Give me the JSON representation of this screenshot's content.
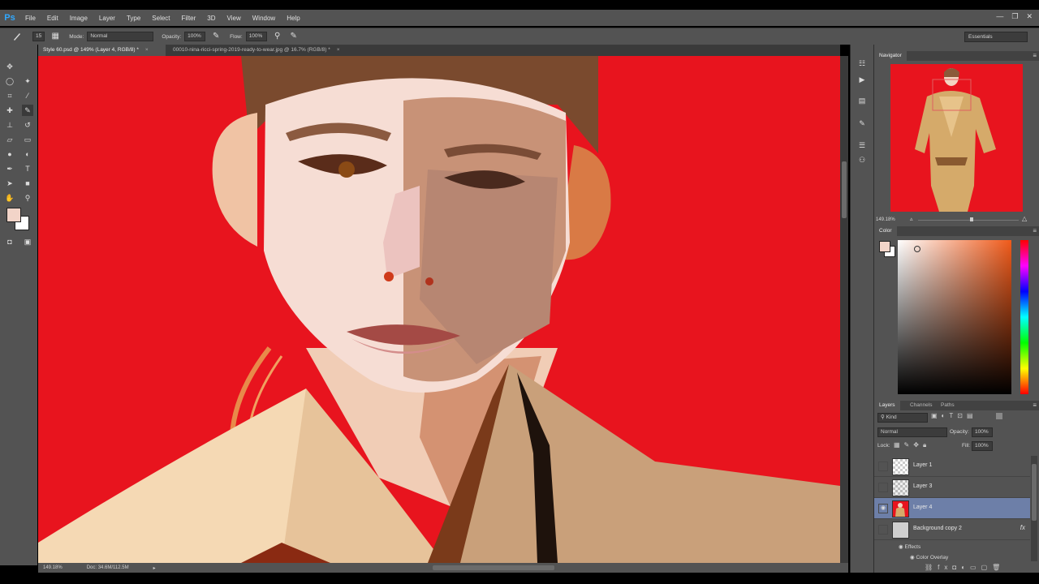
{
  "app": {
    "logo": "Ps"
  },
  "menu": [
    "File",
    "Edit",
    "Image",
    "Layer",
    "Type",
    "Select",
    "Filter",
    "3D",
    "View",
    "Window",
    "Help"
  ],
  "window_controls": {
    "minimize": "—",
    "restore": "❐",
    "close": "✕"
  },
  "options": {
    "brush_size": "15",
    "mode_label": "Mode:",
    "mode_value": "Normal",
    "opacity_label": "Opacity:",
    "opacity_value": "100%",
    "flow_label": "Flow:",
    "flow_value": "100%",
    "workspace": "Essentials"
  },
  "tabs": [
    {
      "label": "Style 60.psd @ 149% (Layer 4, RGB/8) *",
      "close": "×"
    },
    {
      "label": "00010-nina-ricci-spring-2019-ready-to-wear.jpg @ 16.7% (RGB/8) *",
      "close": "×"
    }
  ],
  "status": {
    "zoom": "149.18%",
    "doc": "Doc: 34.6M/112.5M"
  },
  "navigator": {
    "title": "Navigator",
    "zoom": "149.18%"
  },
  "color_panel": {
    "title": "Color",
    "foreground": "#f2d4c8",
    "background": "#ffffff"
  },
  "layers_panel": {
    "tabs": [
      "Layers",
      "Channels",
      "Paths"
    ],
    "filter": "Kind",
    "blend_mode": "Normal",
    "opacity_label": "Opacity:",
    "opacity_value": "100%",
    "lock_label": "Lock:",
    "fill_label": "Fill:",
    "fill_value": "100%",
    "layers": [
      {
        "name": "Layer 1",
        "visible": false,
        "selected": false
      },
      {
        "name": "Layer 3",
        "visible": false,
        "selected": false
      },
      {
        "name": "Layer 4",
        "visible": true,
        "selected": true
      },
      {
        "name": "Background copy 2",
        "visible": false,
        "selected": false,
        "fx": "fx"
      }
    ],
    "effects_label": "Effects",
    "effect_item": "Color Overlay"
  },
  "colors": {
    "canvas_bg": "#e8141e",
    "panel": "#535353",
    "selected_layer": "#6d7fa8"
  }
}
